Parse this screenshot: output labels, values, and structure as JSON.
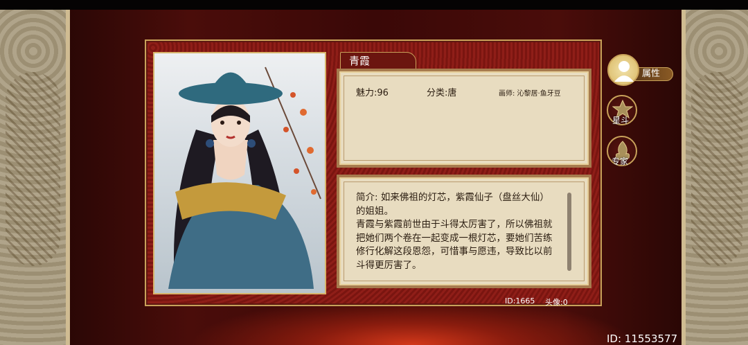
{
  "character": {
    "name": "青霞",
    "charm": "魅力:96",
    "category": "分类:唐",
    "artist": "画师: 沁黎居·鱼牙豆",
    "description": "简介: 如来佛祖的灯芯，紫霞仙子（盘丝大仙）的姐姐。\n青霞与紫霞前世由于斗得太厉害了，所以佛祖就把她们两个卷在一起变成一根灯芯，要她们苦练修行化解这段恩怨，可惜事与愿违，导致比以前斗得更厉害了。",
    "id": "ID:1665",
    "avatar_count": "头像:0"
  },
  "tabs": [
    {
      "label": "属性",
      "icon": "person-icon",
      "active": true
    },
    {
      "label": "星斗",
      "icon": "star-icon",
      "active": false
    },
    {
      "label": "专家",
      "icon": "flame-icon",
      "active": false
    }
  ],
  "player_id": "ID: 11553577",
  "colors": {
    "frame": "#8f1e18",
    "gold": "#c9a25a",
    "parchment": "#e8dcc0"
  }
}
